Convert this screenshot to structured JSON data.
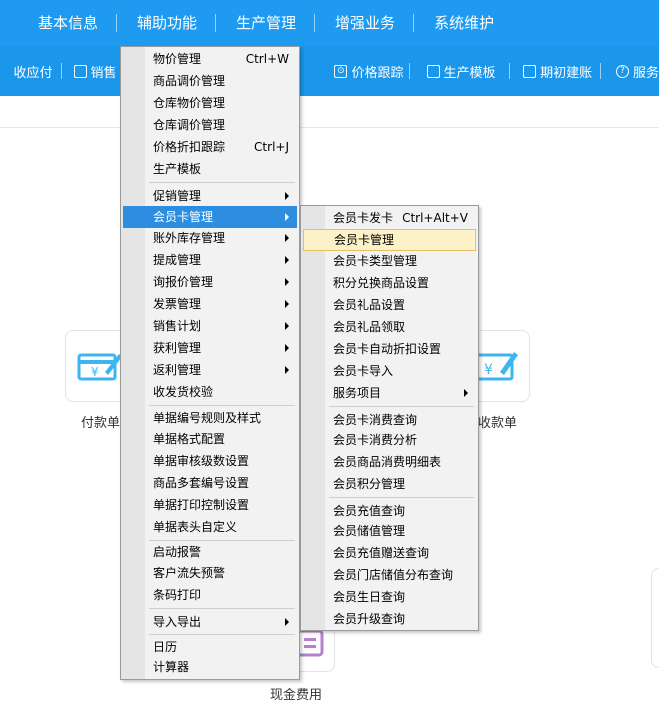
{
  "top_menu": [
    "基本信息",
    "辅助功能",
    "生产管理",
    "增强业务",
    "系统维护"
  ],
  "toolbar": [
    {
      "label": "收应付",
      "icon": "receivable-icon"
    },
    {
      "label": "销售",
      "icon": "sales-icon"
    },
    {
      "label": "价格跟踪",
      "icon": "price-track-icon"
    },
    {
      "label": "生产模板",
      "icon": "template-icon"
    },
    {
      "label": "期初建账",
      "icon": "book-icon"
    },
    {
      "label": "服务",
      "icon": "help-icon"
    }
  ],
  "cards": {
    "payment": "付款单",
    "receipt": "收款单",
    "cash_expense": "现金费用"
  },
  "main_menu": [
    {
      "label": "物价管理",
      "shortcut": "Ctrl+W"
    },
    {
      "label": "商品调价管理"
    },
    {
      "label": "仓库物价管理"
    },
    {
      "label": "仓库调价管理"
    },
    {
      "label": "价格折扣跟踪",
      "shortcut": "Ctrl+J"
    },
    {
      "label": "生产模板"
    },
    {
      "label": "促销管理",
      "submenu": true
    },
    {
      "label": "会员卡管理",
      "submenu": true
    },
    {
      "label": "账外库存管理",
      "submenu": true
    },
    {
      "label": "提成管理",
      "submenu": true
    },
    {
      "label": "询报价管理",
      "submenu": true
    },
    {
      "label": "发票管理",
      "submenu": true
    },
    {
      "label": "销售计划",
      "submenu": true
    },
    {
      "label": "获利管理",
      "submenu": true
    },
    {
      "label": "返利管理",
      "submenu": true
    },
    {
      "label": "收发货校验"
    },
    {
      "label": "单据编号规则及样式"
    },
    {
      "label": "单据格式配置"
    },
    {
      "label": "单据审核级数设置"
    },
    {
      "label": "商品多套编号设置"
    },
    {
      "label": "单据打印控制设置"
    },
    {
      "label": "单据表头自定义"
    },
    {
      "label": "启动报警"
    },
    {
      "label": "客户流失预警"
    },
    {
      "label": "条码打印"
    },
    {
      "label": "导入导出",
      "submenu": true
    },
    {
      "label": "日历"
    },
    {
      "label": "计算器"
    }
  ],
  "sub_menu": [
    {
      "label": "会员卡发卡",
      "shortcut": "Ctrl+Alt+V"
    },
    {
      "label": "会员卡管理"
    },
    {
      "label": "会员卡类型管理"
    },
    {
      "label": "积分兑换商品设置"
    },
    {
      "label": "会员礼品设置"
    },
    {
      "label": "会员礼品领取"
    },
    {
      "label": "会员卡自动折扣设置"
    },
    {
      "label": "会员卡导入"
    },
    {
      "label": "服务项目",
      "submenu": true
    },
    {
      "label": "会员卡消费查询"
    },
    {
      "label": "会员卡消费分析"
    },
    {
      "label": "会员商品消费明细表"
    },
    {
      "label": "会员积分管理"
    },
    {
      "label": "会员充值查询"
    },
    {
      "label": "会员储值管理"
    },
    {
      "label": "会员充值赠送查询"
    },
    {
      "label": "会员门店储值分布查询"
    },
    {
      "label": "会员生日查询"
    },
    {
      "label": "会员升级查询"
    }
  ],
  "colors": {
    "header_blue": "#1e9bf0",
    "menu_highlight": "#2d8ee0",
    "submenu_highlight": "#fdf1c8",
    "card_icon": "#3cb6f0",
    "card_icon_purple": "#b77fcf"
  }
}
